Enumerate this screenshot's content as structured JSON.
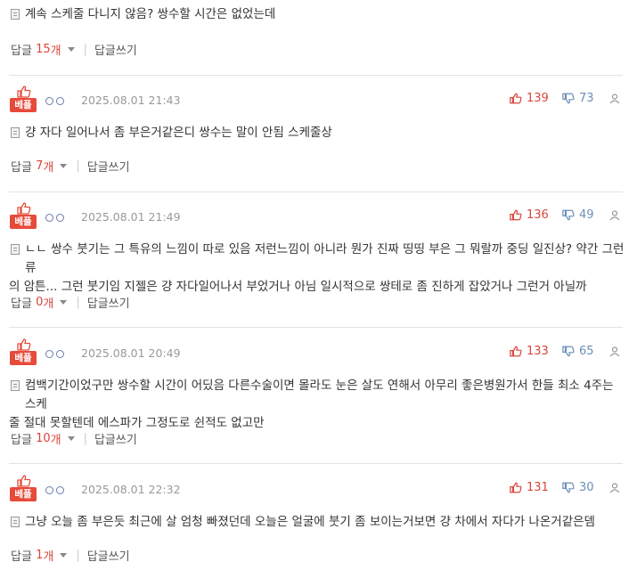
{
  "reply_label": "답글",
  "count_unit": "개",
  "write_reply_label": "답글쓰기",
  "best_badge_label": "베플",
  "colors": {
    "accent_red": "#e64a3a",
    "likes": "#d9453a",
    "dislikes": "#6b8fb8"
  },
  "top_comment": {
    "text": "계속 스케줄 다니지 않음? 쌍수할 시간은 없었는데",
    "reply_count": "15"
  },
  "comments": [
    {
      "date": "2025.08.01 21:43",
      "likes": "139",
      "dislikes": "73",
      "text": "걍 자다 일어나서 좀 부은거같은디 쌍수는 말이 안됨 스케줄상",
      "reply_count": "7"
    },
    {
      "date": "2025.08.01 21:49",
      "likes": "136",
      "dislikes": "49",
      "text_line1": "ㄴㄴ 쌍수 붓기는 그 특유의 느낌이 따로 있음 저런느낌이 아니라 뭔가 진짜 띵띵 부은 그 뭐랄까 중딩 일진상? 약간 그런류",
      "text_line2": "의 암튼... 그런 붓기임 지젤은 걍 자다일어나서 부었거나 아님 일시적으로 쌍테로 좀 진하게 잡았거나 그런거 아닐까",
      "reply_count": "0"
    },
    {
      "date": "2025.08.01 20:49",
      "likes": "133",
      "dislikes": "65",
      "text_line1": "컴백기간이었구만 쌍수할 시간이 어딨음 다른수술이면 몰라도 눈은 살도 연해서 아무리 좋은병원가서 한들 최소 4주는 스케",
      "text_line2": "줄 절대 못할텐데 에스파가 그정도로 쉰적도 없고만",
      "reply_count": "10"
    },
    {
      "date": "2025.08.01 22:32",
      "likes": "131",
      "dislikes": "30",
      "text": "그냥 오늘 좀 부은듯 최근에 살 엄청 빠졌던데 오늘은 얼굴에 붓기 좀 보이는거보면 걍 차에서 자다가 나온거같은뎀",
      "reply_count": "1"
    }
  ]
}
